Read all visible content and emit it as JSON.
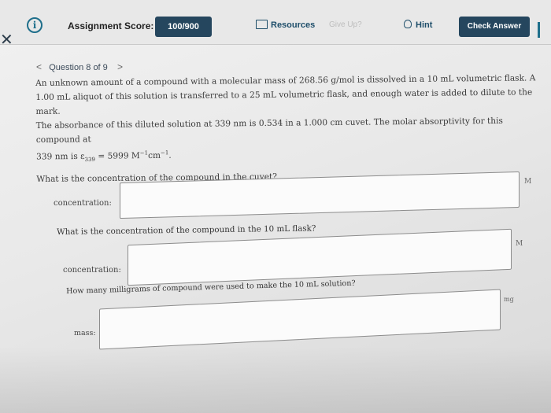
{
  "header": {
    "info_icon": "info-circle-icon",
    "score_label": "Assignment Score:",
    "score_value": "100/900",
    "resources_label": "Resources",
    "give_up_label": "Give Up?",
    "hint_label": "Hint",
    "check_answer_label": "Check Answer"
  },
  "nav": {
    "prev_glyph": "<",
    "question_counter": "Question 8 of 9",
    "next_glyph": ">"
  },
  "question": {
    "line1": "An unknown amount of a compound with a molecular mass of 268.56 g/mol is dissolved in a 10 mL volumetric flask. A",
    "line2": "1.00 mL aliquot of this solution is transferred to a 25 mL volumetric flask, and enough water is added to dilute to the mark.",
    "line3": "The absorbance of this diluted solution at 339 nm is 0.534 in a 1.000 cm cuvet. The molar absorptivity for this compound at",
    "line4_a": "339 nm is ε",
    "line4_sub": "339",
    "line4_b": " = 5999 M",
    "line4_sup1": "−1",
    "line4_c": "cm",
    "line4_sup2": "−1",
    "line4_d": ".",
    "prompt1": "What is the concentration of the compound in the cuvet?"
  },
  "answers": [
    {
      "label": "concentration:",
      "unit": "M",
      "value": ""
    },
    {
      "prompt": "What is the concentration of the compound in the 10 mL flask?",
      "label": "concentration:",
      "unit": "M",
      "value": ""
    },
    {
      "prompt": "How many milligrams of compound were used to make the 10 mL solution?",
      "label": "mass:",
      "unit": "mg",
      "value": ""
    }
  ]
}
